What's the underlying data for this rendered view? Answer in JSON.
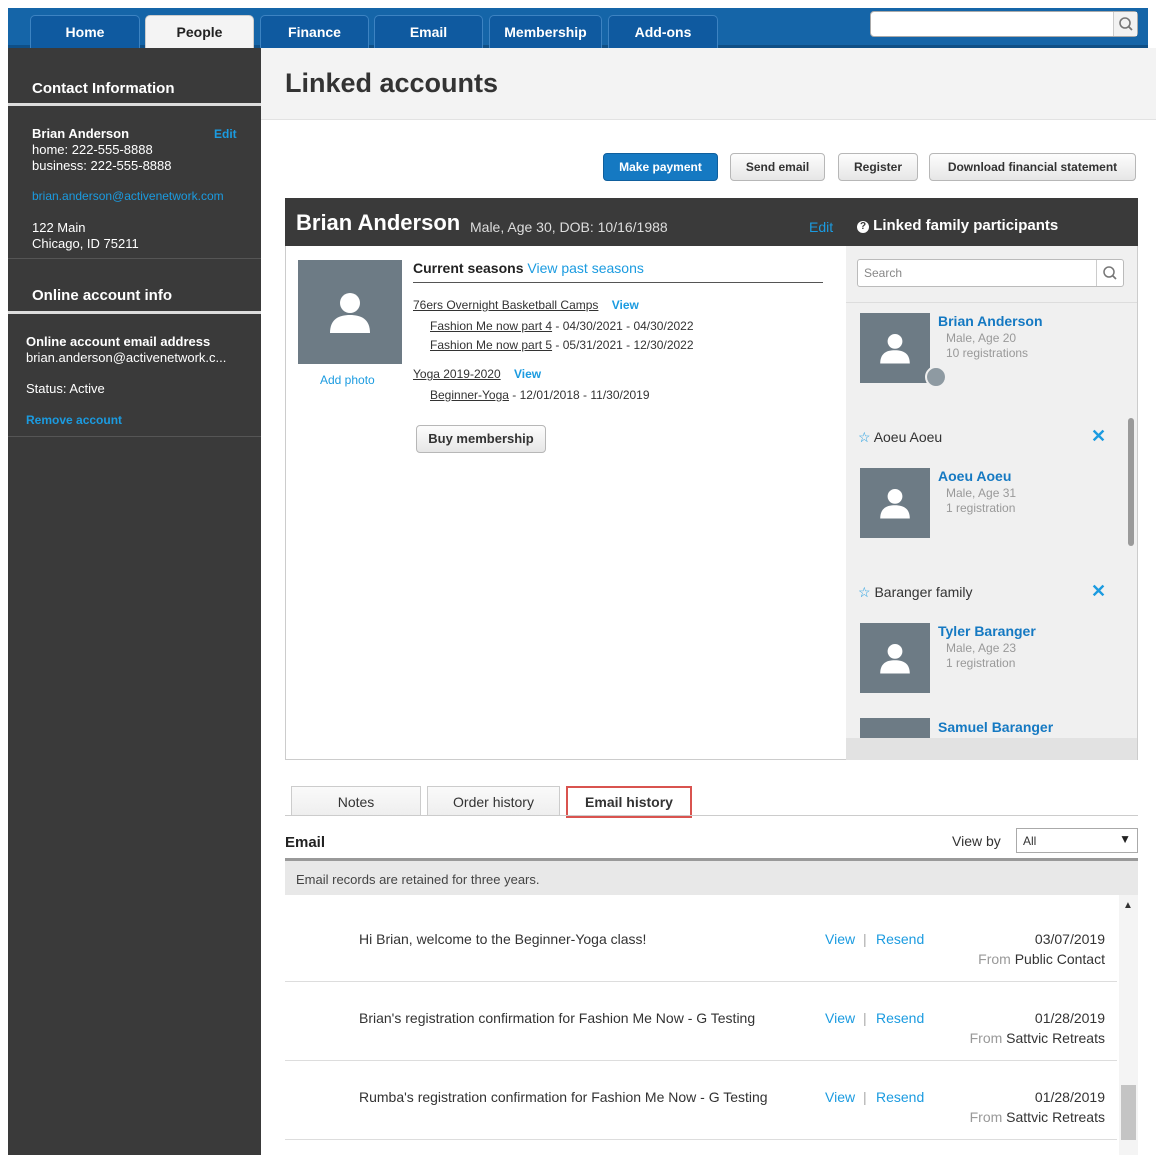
{
  "nav": {
    "tabs": [
      {
        "label": "Home"
      },
      {
        "label": "People"
      },
      {
        "label": "Finance"
      },
      {
        "label": "Email"
      },
      {
        "label": "Membership"
      },
      {
        "label": "Add-ons"
      }
    ],
    "search_placeholder": ""
  },
  "sidebar": {
    "contact_header": "Contact Information",
    "contact_name": "Brian Anderson",
    "edit_label": "Edit",
    "home_phone": "home: 222-555-8888",
    "business_phone": "business: 222-555-8888",
    "email": "brian.anderson@activenetwork.com",
    "address_line1": "122 Main",
    "address_line2": "Chicago, ID 75211",
    "online_header": "Online account info",
    "online_email_label": "Online account email address",
    "online_email_value": "brian.anderson@activenetwork.c...",
    "status": "Status: Active",
    "remove_label": "Remove account"
  },
  "page": {
    "title": "Linked accounts"
  },
  "actions": {
    "make_payment": "Make payment",
    "send_email": "Send email",
    "register": "Register",
    "download": "Download financial statement"
  },
  "profile": {
    "name": "Brian Anderson",
    "meta": "Male, Age 30, DOB: 10/16/1988",
    "edit_label": "Edit",
    "add_photo": "Add photo",
    "current_seasons": "Current seasons",
    "view_past": "View past seasons",
    "programs": [
      {
        "name": "76ers Overnight Basketball Camps",
        "view": "View",
        "sessions": [
          {
            "name": "Fashion Me now part 4",
            "dates": " - 04/30/2021 - 04/30/2022"
          },
          {
            "name": "Fashion Me now part 5",
            "dates": " - 05/31/2021 - 12/30/2022"
          }
        ]
      },
      {
        "name": "Yoga 2019-2020",
        "view": "View",
        "sessions": [
          {
            "name": "Beginner-Yoga",
            "dates": " - 12/01/2018 - 11/30/2019"
          }
        ]
      }
    ],
    "buy_membership": "Buy membership"
  },
  "family": {
    "header": "Linked family participants",
    "search_placeholder": "Search",
    "members": [
      {
        "name": "Brian Anderson",
        "sub1": "Male, Age 20",
        "sub2": "10 registrations"
      },
      {
        "group": "Aoeu Aoeu",
        "name": "Aoeu Aoeu",
        "sub1": "Male, Age 31",
        "sub2": "1 registration"
      },
      {
        "group": "Baranger family",
        "name": "Tyler Baranger",
        "sub1": "Male, Age 23",
        "sub2": "1 registration"
      },
      {
        "name": "Samuel Baranger"
      }
    ]
  },
  "tabs": {
    "notes": "Notes",
    "order_history": "Order history",
    "email_history": "Email history"
  },
  "email": {
    "heading": "Email",
    "view_by_label": "View by",
    "view_by_value": "All",
    "retention_note": "Email records are retained for three years.",
    "view_label": "View",
    "resend_label": "Resend",
    "from_label": "From",
    "rows": [
      {
        "subject": "Hi Brian, welcome to the Beginner-Yoga class!",
        "date": "03/07/2019",
        "from": "Public Contact"
      },
      {
        "subject": "Brian's registration confirmation for Fashion Me Now - G Testing",
        "date": "01/28/2019",
        "from": "Sattvic Retreats"
      },
      {
        "subject": "Rumba's registration confirmation for Fashion Me Now - G Testing",
        "date": "01/28/2019",
        "from": "Sattvic Retreats"
      }
    ]
  },
  "colors": {
    "nav_blue": "#1565a8",
    "sidebar": "#3a3a3a",
    "link": "#1b9be0",
    "highlight": "#d9534f"
  }
}
